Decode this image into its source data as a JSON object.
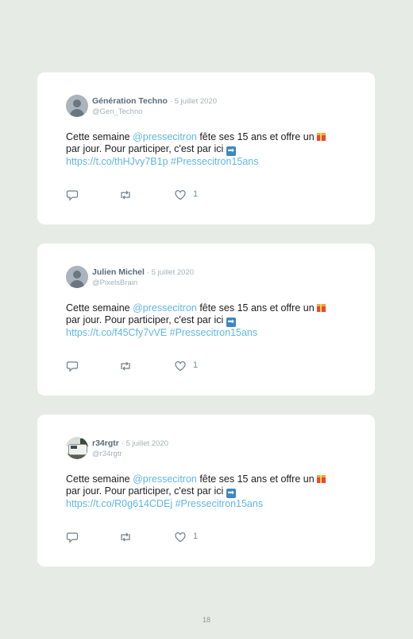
{
  "tweets": [
    {
      "name": "Génération Techno",
      "date": "· 5 juillet 2020",
      "handle": "@Gen_Techno",
      "text_prefix": "Cette semaine ",
      "mention": "@pressecitron",
      "text_mid": " fête ses 15 ans et offre un ",
      "text_line2": " par jour. Pour participer, c'est par ici ",
      "url": "https://t.co/thHJvy7B1p",
      "hashtag": "#Pressecitron15ans",
      "likes": "1",
      "avatar": "default-avatar"
    },
    {
      "name": "Julien Michel",
      "date": "· 5 juillet 2020",
      "handle": "@PixelsBrain",
      "text_prefix": "Cette semaine ",
      "mention": "@pressecitron",
      "text_mid": " fête ses 15 ans et offre un ",
      "text_line2": " par jour. Pour participer, c'est par ici ",
      "url": "https://t.co/f45Cfy7vVE",
      "hashtag": "#Pressecitron15ans",
      "likes": "1",
      "avatar": "default-avatar"
    },
    {
      "name": "r34rgtr",
      "date": "· 5 juillet 2020",
      "handle": "@r34rgtr",
      "text_prefix": "Cette semaine ",
      "mention": "@pressecitron",
      "text_mid": " fête ses 15 ans et offre un ",
      "text_line2": " par jour. Pour participer, c'est par ici ",
      "url": "https://t.co/R0g614CDEj",
      "hashtag": "#Pressecitron15ans",
      "likes": "1",
      "avatar": "photo-avatar"
    }
  ],
  "icons": {
    "gift": "gift-emoji",
    "arrow": "right-arrow-emoji",
    "reply": "reply-icon",
    "retweet": "retweet-icon",
    "like": "heart-icon"
  },
  "colors": {
    "background": "#e6ebe5",
    "card": "#ffffff",
    "link": "#60b7e2",
    "name": "#5a6b78"
  },
  "page_number": "18"
}
